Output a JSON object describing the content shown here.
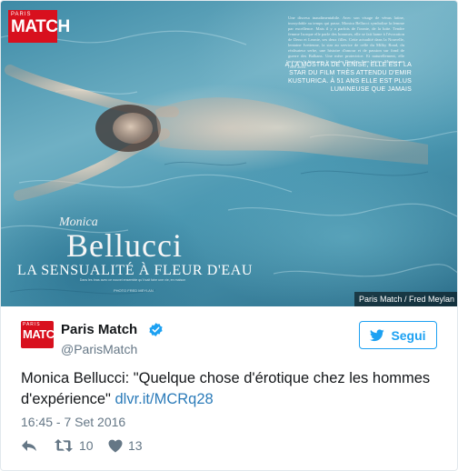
{
  "media": {
    "logo": {
      "top": "PARIS",
      "main": "MATCH"
    },
    "body_text": "Une discesa inaudimentabile. Avec son visage de vénus latine, inoxydable au temps qui passe, Monica Bellucci symbolise la femme par excellence. Mais il y a parfois de l'ironie, de la lutte. Tendre femme Isorque elle parle des hommes, elle se fait hame à l'évocation de Deno et Leonie, ses deux filles. Cette actualité dans la Nouvelle, lentaine Ivettenne, la star au service de celle du Milky Road, du réalisateur serbe, une histoire d'amour et de passion sur fond de guerre des Balkans. Une mère protectrice. Et naturellement, elle présente la bien avec la star des Douglas. Sans hésiter, Monica ose l'être aussi.",
    "highlight": "À LA MOSTRA DE VENISE, ELLE EST LA STAR DU FILM TRÈS ATTENDU D'EMIR KUSTURICA. À 51 ANS ELLE EST PLUS LUMINEUSE QUE JAMAIS",
    "first_name": "Monica",
    "last_name": "Bellucci",
    "subtitle": "LA SENSUALITÉ À FLEUR D'EAU",
    "caption": "Dans les bras avec ce nouvel ensemble qu'il sait faire une vie, en maison",
    "photo_by": "PHOTO FRED MEYLAN",
    "credit": "Paris Match / Fred Meylan"
  },
  "author": {
    "avatar": {
      "top": "PARIS",
      "main": "MATCH"
    },
    "name": "Paris Match",
    "handle": "@ParisMatch",
    "verified": true
  },
  "follow": {
    "label": "Segui",
    "icon": "twitter-bird-icon"
  },
  "tweet": {
    "text": "Monica Bellucci: \"Quelque chose d'érotique chez les hommes d'expérience\"",
    "link": "dlvr.it/MCRq28",
    "timestamp": "16:45 - 7 Set 2016"
  },
  "actions": {
    "reply_icon": "reply-icon",
    "retweet_icon": "retweet-icon",
    "retweet_count": "10",
    "like_icon": "heart-icon",
    "like_count": "13"
  },
  "colors": {
    "brand_blue": "#1da1f2",
    "link_blue": "#2b7bb9",
    "match_red": "#d8101e",
    "secondary_text": "#657786"
  }
}
